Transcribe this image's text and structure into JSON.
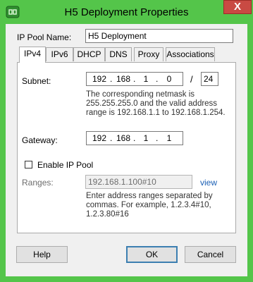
{
  "window": {
    "title": "H5 Deployment Properties",
    "close_glyph": "X",
    "icon": "vsphere-app-icon"
  },
  "ip_pool_name": {
    "label": "IP Pool Name:",
    "value": "H5 Deployment"
  },
  "tabs": [
    {
      "label": "IPv4",
      "active": true
    },
    {
      "label": "IPv6"
    },
    {
      "label": "DHCP"
    },
    {
      "label": "DNS"
    },
    {
      "label": "Proxy"
    },
    {
      "label": "Associations"
    }
  ],
  "ipv4": {
    "subnet_label": "Subnet:",
    "subnet": [
      "192",
      "168",
      "1",
      "0"
    ],
    "prefix_sep": "/",
    "prefix": "24",
    "subnet_note": "The corresponding netmask is 255.255.255.0 and the valid address range is 192.168.1.1 to 192.168.1.254.",
    "gateway_label": "Gateway:",
    "gateway": [
      "192",
      "168",
      "1",
      "1"
    ],
    "enable_label": "Enable IP Pool",
    "enable_checked": false,
    "ranges_label": "Ranges:",
    "ranges_value": "192.168.1.100#10",
    "view_link": "view",
    "ranges_note": "Enter address ranges separated by commas. For example, 1.2.3.4#10, 1.2.3.80#16"
  },
  "buttons": {
    "help": "Help",
    "ok": "OK",
    "cancel": "Cancel"
  },
  "colors": {
    "frame": "#54c54a",
    "close": "#c94a43",
    "link": "#1a5fb4",
    "disabled_text": "#6d6d6d"
  }
}
